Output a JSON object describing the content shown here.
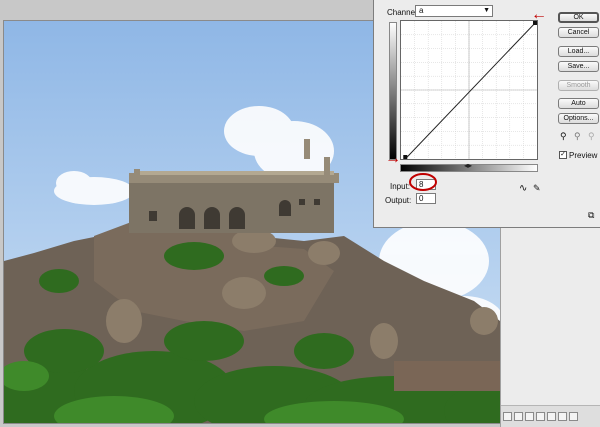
{
  "colors": {
    "annotation_red": "#c00000",
    "sky": "#a9c9ec",
    "dialog_bg": "#ececec"
  },
  "curves_dialog": {
    "channel_label": "Channel:",
    "channel_value": "a",
    "input_label": "Input:",
    "input_value": "8",
    "output_label": "Output:",
    "output_value": "0",
    "buttons": {
      "ok": "OK",
      "cancel": "Cancel",
      "load": "Load...",
      "save": "Save...",
      "smooth": "Smooth",
      "auto": "Auto",
      "options": "Options..."
    },
    "preview_label": "Preview",
    "preview_checked": true,
    "curve_points": [
      [
        8,
        0
      ],
      [
        255,
        255
      ]
    ],
    "icons": [
      "curve-tool-icon",
      "pencil-tool-icon",
      "black-eyedropper-icon",
      "gray-eyedropper-icon",
      "white-eyedropper-icon",
      "resize-icon",
      "split-handle-icon"
    ]
  },
  "annotations": [
    "arrow-top-right",
    "arrow-bottom-left",
    "circle-input-value"
  ]
}
